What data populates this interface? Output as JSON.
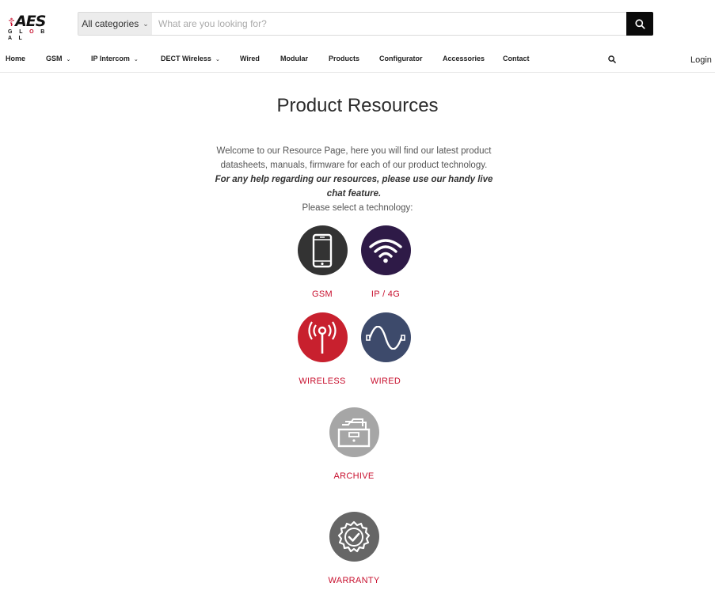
{
  "logo": {
    "brand": "AES",
    "sub": "GLOBAL"
  },
  "search": {
    "category": "All categories",
    "placeholder": "What are you looking for?",
    "value": ""
  },
  "nav": {
    "items": [
      {
        "label": "Home"
      },
      {
        "label": "GSM"
      },
      {
        "label": "IP Intercom"
      },
      {
        "label": "DECT Wireless"
      },
      {
        "label": "Wired"
      },
      {
        "label": "Modular"
      },
      {
        "label": "Products"
      },
      {
        "label": "Configurator"
      },
      {
        "label": "Accessories"
      },
      {
        "label": "Contact"
      }
    ],
    "login": "Login"
  },
  "page": {
    "title": "Product Resources",
    "intro_line1": "Welcome to our Resource Page, here you will find our latest product datasheets, manuals, firmware for each of our product technology.",
    "intro_bold": "For any help regarding our resources, please use our handy live chat feature.",
    "select_prompt": "Please select a technology:"
  },
  "tiles": [
    {
      "label": "GSM",
      "icon": "smartphone-icon",
      "color": "#333333"
    },
    {
      "label": "IP / 4G",
      "icon": "wifi-icon",
      "color": "#2e1a47"
    },
    {
      "label": "WIRELESS",
      "icon": "antenna-icon",
      "color": "#c8202e"
    },
    {
      "label": "WIRED",
      "icon": "cable-wave-icon",
      "color": "#3d4a6b"
    },
    {
      "label": "ARCHIVE",
      "icon": "archive-box-icon",
      "color": "#a6a6a6"
    },
    {
      "label": "WARRANTY",
      "icon": "warranty-badge-icon",
      "color": "#666666"
    }
  ],
  "colors": {
    "accent": "#c8102e",
    "search_button": "#0a0a0a"
  }
}
